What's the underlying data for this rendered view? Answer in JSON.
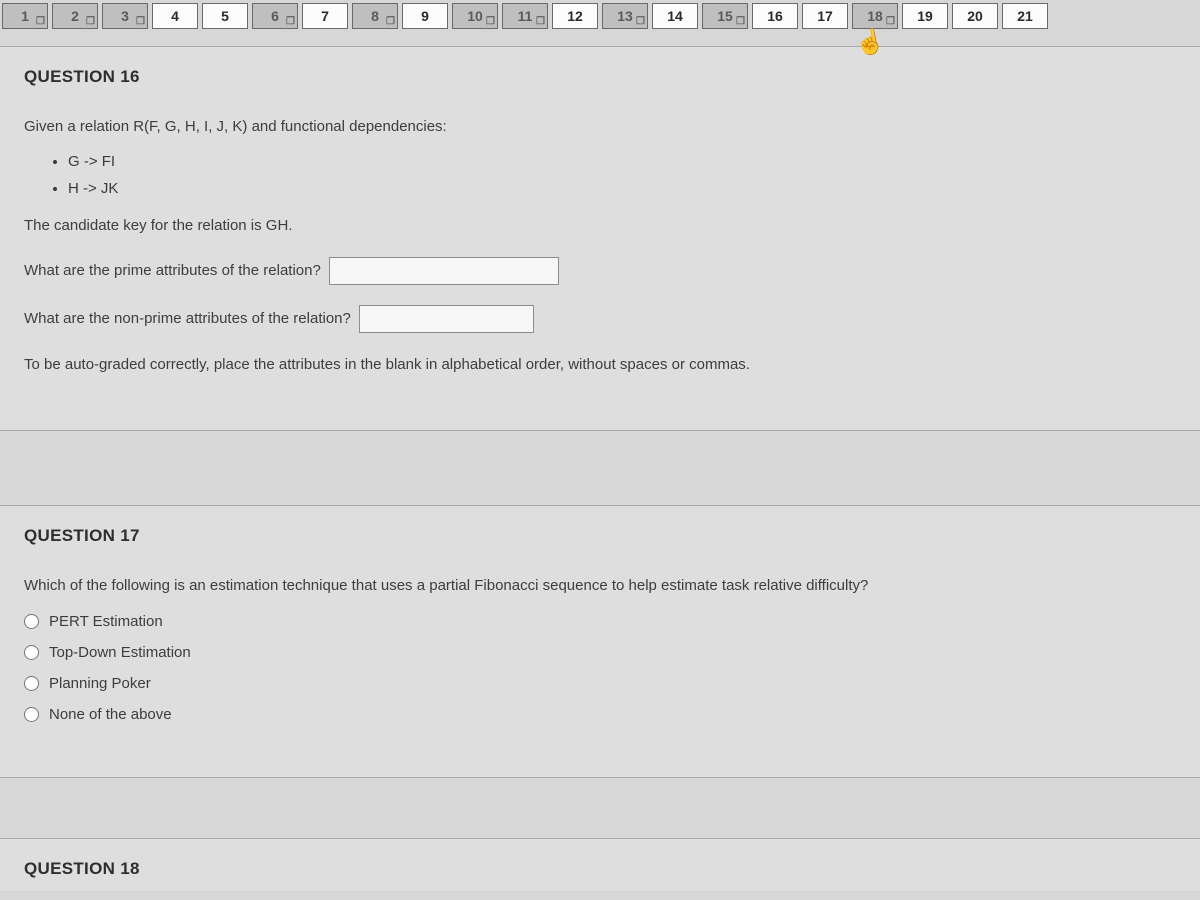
{
  "nav": {
    "items": [
      {
        "num": "1",
        "answered": true,
        "flag": true
      },
      {
        "num": "2",
        "answered": true,
        "flag": true
      },
      {
        "num": "3",
        "answered": true,
        "flag": true
      },
      {
        "num": "4",
        "answered": false,
        "flag": false
      },
      {
        "num": "5",
        "answered": false,
        "flag": false
      },
      {
        "num": "6",
        "answered": true,
        "flag": true
      },
      {
        "num": "7",
        "answered": false,
        "flag": false
      },
      {
        "num": "8",
        "answered": true,
        "flag": true
      },
      {
        "num": "9",
        "answered": false,
        "flag": false
      },
      {
        "num": "10",
        "answered": true,
        "flag": true
      },
      {
        "num": "11",
        "answered": true,
        "flag": true
      },
      {
        "num": "12",
        "answered": false,
        "flag": false
      },
      {
        "num": "13",
        "answered": true,
        "flag": true
      },
      {
        "num": "14",
        "answered": false,
        "flag": false
      },
      {
        "num": "15",
        "answered": true,
        "flag": true
      },
      {
        "num": "16",
        "answered": false,
        "flag": false
      },
      {
        "num": "17",
        "answered": false,
        "flag": false
      },
      {
        "num": "18",
        "answered": true,
        "flag": true
      },
      {
        "num": "19",
        "answered": false,
        "flag": false
      },
      {
        "num": "20",
        "answered": false,
        "flag": false
      },
      {
        "num": "21",
        "answered": false,
        "flag": false
      }
    ]
  },
  "q16": {
    "title": "QUESTION 16",
    "intro": "Given a relation R(F, G, H, I, J, K) and functional dependencies:",
    "fd1": "G -> FI",
    "fd2": "H -> JK",
    "candidate": "The candidate key for the relation is GH.",
    "prime_prompt": "What are the prime attributes of the relation?",
    "nonprime_prompt": "What are the non-prime attributes of the relation?",
    "note": "To be auto-graded correctly, place the attributes in the blank in alphabetical order, without spaces or commas."
  },
  "q17": {
    "title": "QUESTION 17",
    "prompt": "Which of the following is an estimation technique that uses a partial Fibonacci sequence to help estimate task relative difficulty?",
    "opt1": "PERT Estimation",
    "opt2": "Top-Down Estimation",
    "opt3": "Planning Poker",
    "opt4": "None of the above"
  },
  "q18": {
    "title": "QUESTION 18"
  }
}
